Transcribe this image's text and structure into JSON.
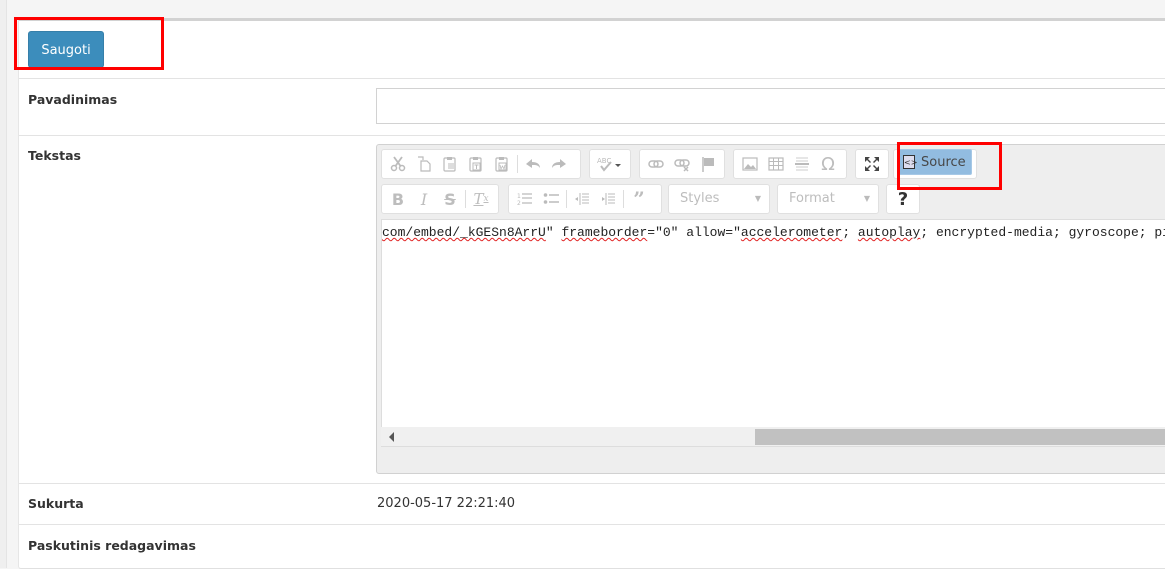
{
  "toolbar": {
    "save_label": "Saugoti"
  },
  "form": {
    "name_label": "Pavadinimas",
    "name_value": "",
    "text_label": "Tekstas",
    "created_label": "Sukurta",
    "created_value": "2020-05-17 22:21:40",
    "edited_label": "Paskutinis redagavimas",
    "edited_value": ""
  },
  "editor": {
    "toolbar_row1": [
      {
        "group": "clipboard",
        "items": [
          "cut-icon",
          "copy-icon",
          "paste-icon",
          "paste-text-icon",
          "paste-word-icon",
          "undo-icon",
          "redo-icon"
        ]
      },
      {
        "group": "spellcheck",
        "items": [
          "spellcheck-icon"
        ]
      },
      {
        "group": "links",
        "items": [
          "link-icon",
          "unlink-icon",
          "anchor-icon"
        ]
      },
      {
        "group": "insert",
        "items": [
          "image-icon",
          "table-icon",
          "horizontal-line-icon",
          "special-char-icon"
        ]
      },
      {
        "group": "tools",
        "items": [
          "maximize-icon"
        ]
      }
    ],
    "source_label": "Source",
    "toolbar_row2": [
      {
        "group": "basicstyles",
        "items": [
          "bold-icon",
          "italic-icon",
          "strike-icon",
          "remove-format-icon"
        ]
      },
      {
        "group": "paragraph",
        "items": [
          "numbered-list-icon",
          "bulleted-list-icon",
          "outdent-icon",
          "indent-icon",
          "blockquote-icon"
        ]
      }
    ],
    "styles_label": "Styles",
    "format_label": "Format",
    "help_label": "?",
    "source_code": {
      "parts": [
        {
          "t": "com/embed/_kGESn8ArrU",
          "spell": true
        },
        {
          "t": "\" ",
          "spell": false
        },
        {
          "t": "frameborder",
          "spell": true
        },
        {
          "t": "=\"0\" allow=\"",
          "spell": false
        },
        {
          "t": "accelerometer",
          "spell": true
        },
        {
          "t": "; ",
          "spell": false
        },
        {
          "t": "autoplay",
          "spell": true
        },
        {
          "t": "; encrypted-media; gyroscope; picture-in-picture\" allowfullscreen></iframe>",
          "spell": false
        }
      ]
    }
  },
  "colors": {
    "primary": "#3c8dbc",
    "highlight": "#ff0000",
    "source_active": "#92bce0"
  }
}
